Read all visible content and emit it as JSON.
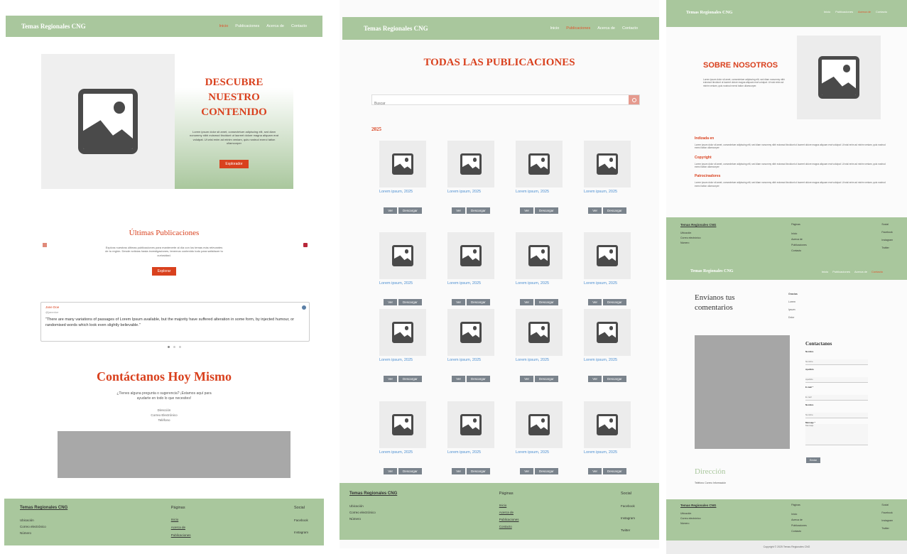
{
  "brand": "Temas Regionales CNG",
  "nav": [
    "Inicio",
    "Publicaciones",
    "Acerca de",
    "Contacto"
  ],
  "home": {
    "hero_title": [
      "DESCUBRE",
      "NUESTRO",
      "CONTENIDO"
    ],
    "hero_text": "Lorem ipsum dolor sit amet, consectetuer adipiscing elit, sed diam nonummy nibh euismod tincidunt ut laoreet dolore magna aliquam erat volutpat. Ut wisi enim ad minim veniam, quis nostrud exerci tation ullamcorper",
    "hero_button": "Explorador",
    "latest_title": "Últimas Publicaciones",
    "latest_text": "Explora nuestras últimas publicaciones para mantenerte al día con los temas más relevantes de tu región. Desde noticias hasta investigaciones, tenemos contenido todo para satisfacer tu curiosidad.",
    "latest_button": "Explorar",
    "tweet_name": "Jane Doe",
    "tweet_handle": "@janedoe",
    "tweet_text": "\"There are many variations of passages of Lorem Ipsum available, but the majority have suffered alteration in some form, by injected humour, or randomised words which look even slightly believable.\"",
    "contact_title": "Contáctanos Hoy Mismo",
    "contact_text": "¿Tienes alguna pregunta o sugerencia? ¡Estamos aquí para ayudarte en todo lo que necesites!",
    "contact_lines": [
      "Dirección",
      "Correo Electrónico",
      "Teléfono"
    ]
  },
  "footer": {
    "col1": [
      "Ubicación",
      "Correo electrónico",
      "Número"
    ],
    "pages_title": "Páginas",
    "pages": [
      "Inicio",
      "Acerca de",
      "Publicaciones",
      "Contacto"
    ],
    "social_title": "Social",
    "social": [
      "Facebook",
      "Instagram",
      "Twitter"
    ]
  },
  "pubs": {
    "title": "TODAS LAS PUBLICACIONES",
    "search_placeholder": "Buscar",
    "year": "2025",
    "card_label": "Lorem ipsum, 2025",
    "view_btn": "Ver",
    "download_btn": "Descargar"
  },
  "about": {
    "title": "SOBRE NOSOTROS",
    "intro": "Lorem ipsum dolor sit amet, consectetuer adipiscing elit, sed diam nonummy nibh euismod tincidunt ut laoreet dolore magna aliquam erat volutpat. Ut wisi enim ad minim veniam, quis nostrud exerci tation ullamcorper.",
    "sections": [
      {
        "h": "Indizada en",
        "t": "Lorem ipsum dolor sit amet, consectetuer adipiscing elit, sed diam nonummy nibh euismod tincidunt ut laoreet dolore magna aliquam erat volutpat. Ut wisi enim ad minim veniam, quis nostrud exerci tation ullamcorper"
      },
      {
        "h": "Copyright",
        "t": "Lorem ipsum dolor sit amet, consectetuer adipiscing elit, sed diam nonummy nibh euismod tincidunt ut laoreet dolore magna aliquam erat volutpat. Ut wisi enim ad minim veniam, quis nostrud exerci tation ullamcorper"
      },
      {
        "h": "Patrocinadores",
        "t": "Lorem ipsum dolor sit amet, consectetuer adipiscing elit, sed diam nonummy nibh euismod tincidunt ut laoreet dolore magna aliquam erat volutpat. Ut wisi enim ad minim veniam, quis nostrud exerci tation ullamcorper"
      }
    ]
  },
  "contact": {
    "feedback_title": "Envíanos tus comentarios",
    "side_title": "Gracias",
    "side_items": [
      "Lorem",
      "Ipsum",
      "Dolor"
    ],
    "form_title": "Contactanos",
    "fields": [
      {
        "label": "Nombre",
        "placeholder": "Nombre"
      },
      {
        "label": "Apellido",
        "placeholder": "Apellido"
      },
      {
        "label": "E-mail *",
        "placeholder": "E-mail"
      },
      {
        "label": "Nombre",
        "placeholder": "Nombre"
      }
    ],
    "message_label": "Mensaje *",
    "message_placeholder": "Mensaje",
    "send_btn": "Enviar",
    "address_title": "Dirección",
    "address_text": "Teléfono Correo Información",
    "copyright": "Copyright © 2025 Temas Regionales CNG"
  }
}
